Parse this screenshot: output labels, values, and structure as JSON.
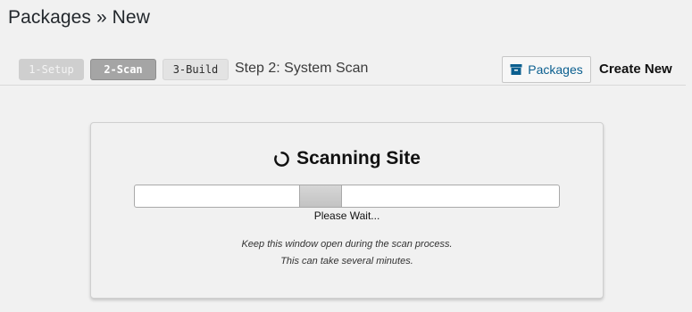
{
  "page": {
    "title": "Packages » New"
  },
  "wizard": {
    "steps": [
      {
        "label": "1-Setup",
        "state": "done"
      },
      {
        "label": "2-Scan",
        "state": "active"
      },
      {
        "label": "3-Build",
        "state": "pending"
      }
    ],
    "caption": "Step 2: System Scan"
  },
  "header_actions": {
    "packages_label": "Packages",
    "packages_icon": "archive-icon",
    "create_new_label": "Create New"
  },
  "scan": {
    "title": "Scanning Site",
    "icon": "spinner-icon",
    "progress_fraction": 0.43,
    "status_text": "Please Wait...",
    "note_line1": "Keep this window open during the scan process.",
    "note_line2": "This can take several minutes."
  },
  "colors": {
    "link_blue": "#0b5f8f",
    "active_step": "#a5a5a5",
    "inactive_step": "#cfcfcf"
  }
}
